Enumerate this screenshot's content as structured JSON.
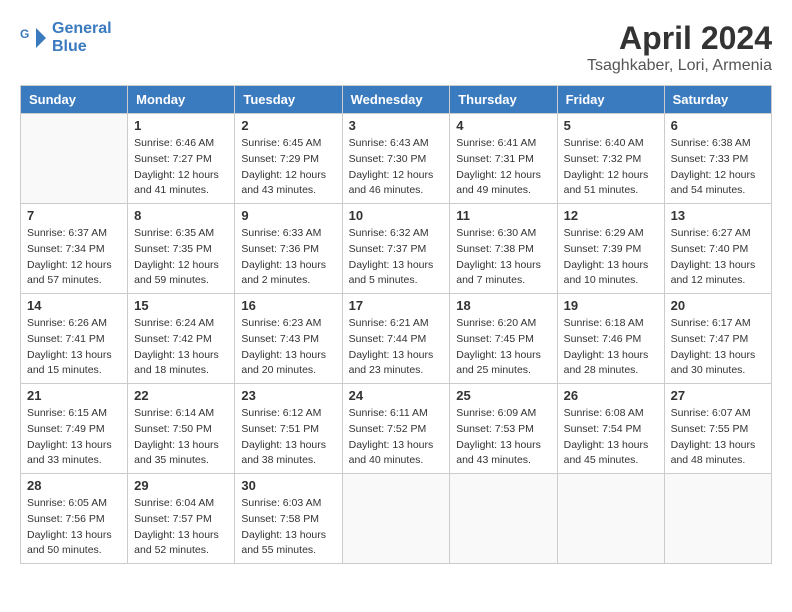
{
  "header": {
    "logo_line1": "General",
    "logo_line2": "Blue",
    "month": "April 2024",
    "location": "Tsaghkaber, Lori, Armenia"
  },
  "days_of_week": [
    "Sunday",
    "Monday",
    "Tuesday",
    "Wednesday",
    "Thursday",
    "Friday",
    "Saturday"
  ],
  "weeks": [
    [
      {
        "day": "",
        "empty": true
      },
      {
        "day": "1",
        "sunrise": "6:46 AM",
        "sunset": "7:27 PM",
        "daylight": "12 hours and 41 minutes."
      },
      {
        "day": "2",
        "sunrise": "6:45 AM",
        "sunset": "7:29 PM",
        "daylight": "12 hours and 43 minutes."
      },
      {
        "day": "3",
        "sunrise": "6:43 AM",
        "sunset": "7:30 PM",
        "daylight": "12 hours and 46 minutes."
      },
      {
        "day": "4",
        "sunrise": "6:41 AM",
        "sunset": "7:31 PM",
        "daylight": "12 hours and 49 minutes."
      },
      {
        "day": "5",
        "sunrise": "6:40 AM",
        "sunset": "7:32 PM",
        "daylight": "12 hours and 51 minutes."
      },
      {
        "day": "6",
        "sunrise": "6:38 AM",
        "sunset": "7:33 PM",
        "daylight": "12 hours and 54 minutes."
      }
    ],
    [
      {
        "day": "7",
        "sunrise": "6:37 AM",
        "sunset": "7:34 PM",
        "daylight": "12 hours and 57 minutes."
      },
      {
        "day": "8",
        "sunrise": "6:35 AM",
        "sunset": "7:35 PM",
        "daylight": "12 hours and 59 minutes."
      },
      {
        "day": "9",
        "sunrise": "6:33 AM",
        "sunset": "7:36 PM",
        "daylight": "13 hours and 2 minutes."
      },
      {
        "day": "10",
        "sunrise": "6:32 AM",
        "sunset": "7:37 PM",
        "daylight": "13 hours and 5 minutes."
      },
      {
        "day": "11",
        "sunrise": "6:30 AM",
        "sunset": "7:38 PM",
        "daylight": "13 hours and 7 minutes."
      },
      {
        "day": "12",
        "sunrise": "6:29 AM",
        "sunset": "7:39 PM",
        "daylight": "13 hours and 10 minutes."
      },
      {
        "day": "13",
        "sunrise": "6:27 AM",
        "sunset": "7:40 PM",
        "daylight": "13 hours and 12 minutes."
      }
    ],
    [
      {
        "day": "14",
        "sunrise": "6:26 AM",
        "sunset": "7:41 PM",
        "daylight": "13 hours and 15 minutes."
      },
      {
        "day": "15",
        "sunrise": "6:24 AM",
        "sunset": "7:42 PM",
        "daylight": "13 hours and 18 minutes."
      },
      {
        "day": "16",
        "sunrise": "6:23 AM",
        "sunset": "7:43 PM",
        "daylight": "13 hours and 20 minutes."
      },
      {
        "day": "17",
        "sunrise": "6:21 AM",
        "sunset": "7:44 PM",
        "daylight": "13 hours and 23 minutes."
      },
      {
        "day": "18",
        "sunrise": "6:20 AM",
        "sunset": "7:45 PM",
        "daylight": "13 hours and 25 minutes."
      },
      {
        "day": "19",
        "sunrise": "6:18 AM",
        "sunset": "7:46 PM",
        "daylight": "13 hours and 28 minutes."
      },
      {
        "day": "20",
        "sunrise": "6:17 AM",
        "sunset": "7:47 PM",
        "daylight": "13 hours and 30 minutes."
      }
    ],
    [
      {
        "day": "21",
        "sunrise": "6:15 AM",
        "sunset": "7:49 PM",
        "daylight": "13 hours and 33 minutes."
      },
      {
        "day": "22",
        "sunrise": "6:14 AM",
        "sunset": "7:50 PM",
        "daylight": "13 hours and 35 minutes."
      },
      {
        "day": "23",
        "sunrise": "6:12 AM",
        "sunset": "7:51 PM",
        "daylight": "13 hours and 38 minutes."
      },
      {
        "day": "24",
        "sunrise": "6:11 AM",
        "sunset": "7:52 PM",
        "daylight": "13 hours and 40 minutes."
      },
      {
        "day": "25",
        "sunrise": "6:09 AM",
        "sunset": "7:53 PM",
        "daylight": "13 hours and 43 minutes."
      },
      {
        "day": "26",
        "sunrise": "6:08 AM",
        "sunset": "7:54 PM",
        "daylight": "13 hours and 45 minutes."
      },
      {
        "day": "27",
        "sunrise": "6:07 AM",
        "sunset": "7:55 PM",
        "daylight": "13 hours and 48 minutes."
      }
    ],
    [
      {
        "day": "28",
        "sunrise": "6:05 AM",
        "sunset": "7:56 PM",
        "daylight": "13 hours and 50 minutes."
      },
      {
        "day": "29",
        "sunrise": "6:04 AM",
        "sunset": "7:57 PM",
        "daylight": "13 hours and 52 minutes."
      },
      {
        "day": "30",
        "sunrise": "6:03 AM",
        "sunset": "7:58 PM",
        "daylight": "13 hours and 55 minutes."
      },
      {
        "day": "",
        "empty": true
      },
      {
        "day": "",
        "empty": true
      },
      {
        "day": "",
        "empty": true
      },
      {
        "day": "",
        "empty": true
      }
    ]
  ],
  "labels": {
    "sunrise": "Sunrise:",
    "sunset": "Sunset:",
    "daylight": "Daylight:"
  }
}
